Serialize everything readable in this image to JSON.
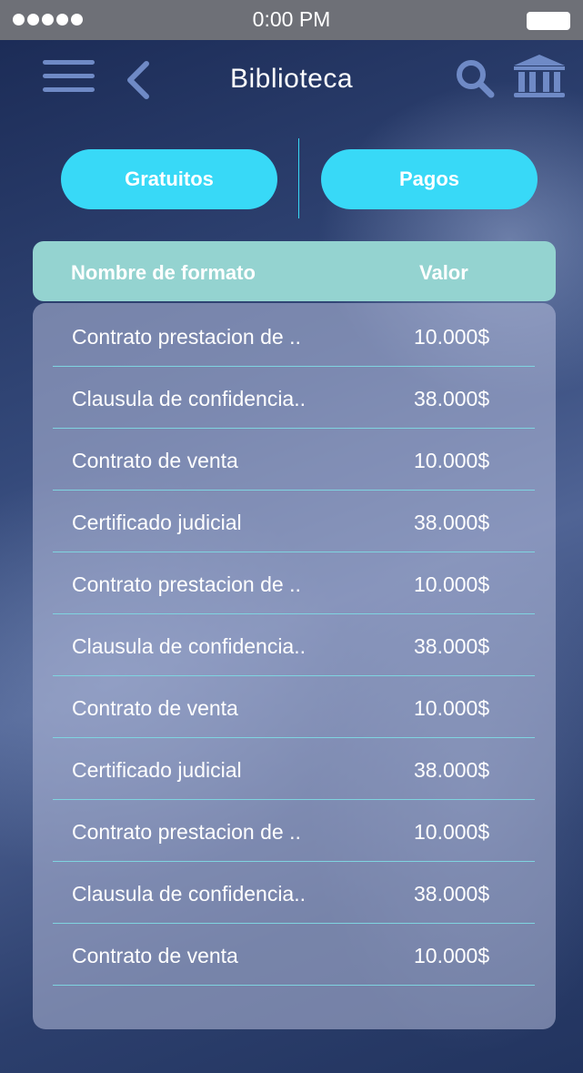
{
  "status_bar": {
    "time": "0:00 PM"
  },
  "header": {
    "title": "Biblioteca",
    "icons": [
      "hamburger-menu-icon",
      "back-chevron-icon",
      "search-icon",
      "bank-icon"
    ]
  },
  "tabs": {
    "free_label": "Gratuitos",
    "paid_label": "Pagos"
  },
  "table": {
    "headers": {
      "name": "Nombre de formato",
      "value": "Valor"
    },
    "rows": [
      {
        "name": "Contrato prestacion de ..",
        "value": "10.000$"
      },
      {
        "name": "Clausula de confidencia..",
        "value": "38.000$"
      },
      {
        "name": "Contrato de venta",
        "value": "10.000$"
      },
      {
        "name": "Certificado judicial",
        "value": "38.000$"
      },
      {
        "name": "Contrato prestacion de ..",
        "value": "10.000$"
      },
      {
        "name": "Clausula de confidencia..",
        "value": "38.000$"
      },
      {
        "name": "Contrato de venta",
        "value": "10.000$"
      },
      {
        "name": "Certificado judicial",
        "value": "38.000$"
      },
      {
        "name": "Contrato prestacion de ..",
        "value": "10.000$"
      },
      {
        "name": "Clausula de confidencia..",
        "value": "38.000$"
      },
      {
        "name": "Contrato de venta",
        "value": "10.000$"
      }
    ]
  },
  "colors": {
    "accent": "#38d9f7",
    "icon": "#6f8ac6",
    "table_header": "#94d3d0",
    "status_bar": "#6e7077"
  }
}
